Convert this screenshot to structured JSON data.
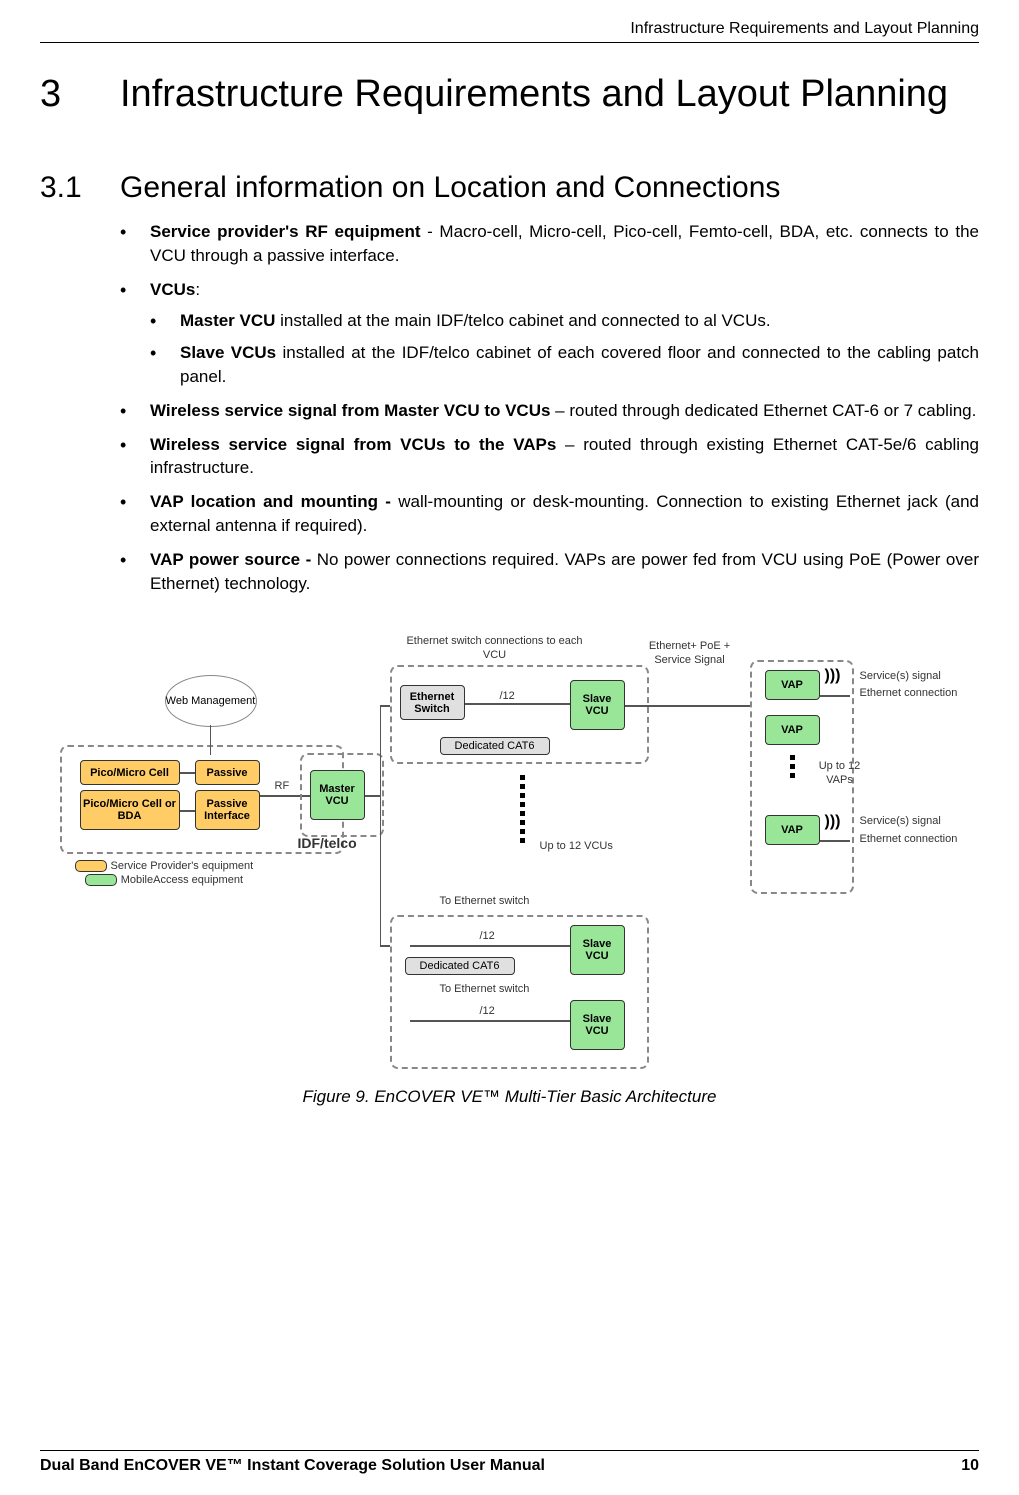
{
  "header": {
    "right": "Infrastructure Requirements and Layout Planning"
  },
  "chapter": {
    "number": "3",
    "title": "Infrastructure Requirements and Layout Planning"
  },
  "section": {
    "number": "3.1",
    "title": "General information on Location and Connections"
  },
  "bullets": {
    "b1_bold": "Service provider's RF equipment",
    "b1_rest": " - Macro-cell, Micro-cell, Pico-cell, Femto-cell, BDA, etc. connects to the VCU through a passive interface.",
    "b2_bold": "VCUs",
    "b2_rest": ":",
    "b2a_bold": "Master VCU",
    "b2a_rest": " installed at the main IDF/telco cabinet and connected to al VCUs.",
    "b2b_bold": "Slave VCUs",
    "b2b_rest": " installed at the IDF/telco cabinet of each covered floor and connected to the cabling patch panel.",
    "b3_bold": "Wireless service signal from Master VCU to VCUs",
    "b3_rest": " – routed through dedicated Ethernet CAT-6 or 7 cabling.",
    "b4_bold": "Wireless service signal from VCUs to the VAPs",
    "b4_rest": " – routed through existing Ethernet CAT-5e/6 cabling infrastructure.",
    "b5_bold": "VAP location and mounting -",
    "b5_rest": " wall-mounting or desk-mounting. Connection to existing Ethernet jack (and external antenna if required).",
    "b6_bold": "VAP power source -",
    "b6_rest": " No power connections required. VAPs are power fed from VCU using PoE (Power over Ethernet) technology."
  },
  "diagram": {
    "web_mgmt": "Web Management",
    "pico_micro": "Pico/Micro Cell",
    "pico_micro_bda": "Pico/Micro Cell or BDA",
    "passive": "Passive",
    "passive_if": "Passive Interface",
    "rf": "RF",
    "master_vcu": "Master VCU",
    "idf_telco": "IDF/telco",
    "eth_switch": "Ethernet Switch",
    "eth_switch_conn": "Ethernet switch connections to each VCU",
    "slash12": "/12",
    "slave_vcu": "Slave VCU",
    "dedicated_cat6": "Dedicated CAT6",
    "to_eth_switch": "To Ethernet switch",
    "up_to_12_vcus": "Up to 12 VCUs",
    "vap": "VAP",
    "up_to_12_vaps": "Up to 12 VAPs",
    "eth_poe_svc": "Ethernet+ PoE + Service Signal",
    "service_signal": "Service(s) signal",
    "eth_conn": "Ethernet connection",
    "legend_sp": "Service Provider's equipment",
    "legend_ma": "MobileAccess equipment"
  },
  "figure_caption": "Figure 9. EnCOVER VE™ Multi-Tier Basic Architecture",
  "footer": {
    "left": "Dual Band EnCOVER VE™ Instant Coverage Solution User Manual",
    "right": "10"
  }
}
